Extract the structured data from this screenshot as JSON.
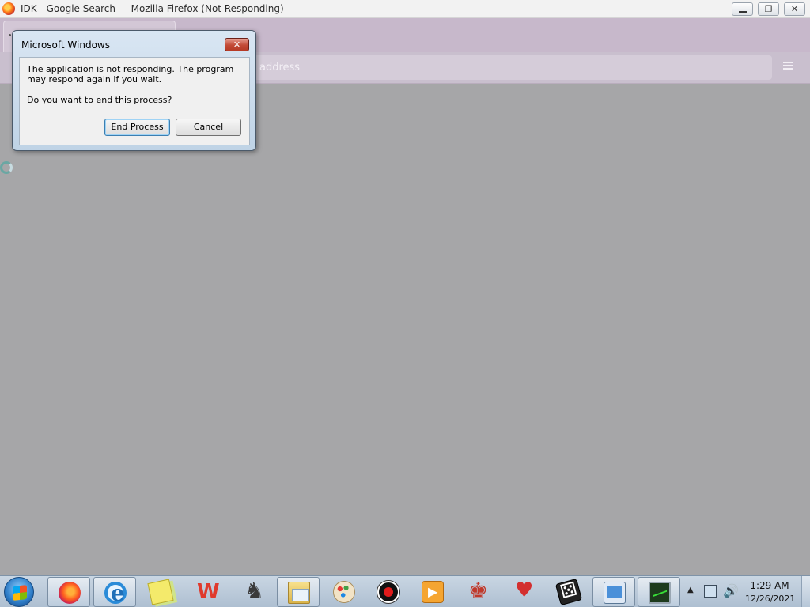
{
  "firefox": {
    "window_title": "IDK - Google Search — Mozilla Firefox (Not Responding)",
    "window_controls": {
      "minimize": "minimize-icon",
      "maximize": "restore-icon",
      "close": "close-icon"
    },
    "urlbar_placeholder": "address",
    "menu_icon": "hamburger-menu-icon"
  },
  "dialog": {
    "title": "Microsoft Windows",
    "message": "The application is not responding. The program may respond again if you wait.",
    "question": "Do you want to end this process?",
    "end_label": "End Process",
    "cancel_label": "Cancel"
  },
  "taskbar": {
    "items": [
      {
        "name": "firefox",
        "icon": "firefox-icon",
        "active": true
      },
      {
        "name": "internet-explorer",
        "icon": "internet-explorer-icon",
        "active": true
      },
      {
        "name": "sticky-notes",
        "icon": "sticky-notes-icon",
        "active": false
      },
      {
        "name": "wps-office",
        "icon": "wps-office-icon",
        "active": false
      },
      {
        "name": "chess",
        "icon": "chess-icon",
        "active": false
      },
      {
        "name": "file-explorer",
        "icon": "folder-icon",
        "active": true
      },
      {
        "name": "paint",
        "icon": "paint-palette-icon",
        "active": false
      },
      {
        "name": "screen-recorder",
        "icon": "record-icon",
        "active": false
      },
      {
        "name": "media-player",
        "icon": "media-player-icon",
        "active": false
      },
      {
        "name": "solitaire",
        "icon": "cards-king-icon",
        "active": false
      },
      {
        "name": "hearts",
        "icon": "hearts-icon",
        "active": false
      },
      {
        "name": "dice-game",
        "icon": "dice-icon",
        "active": false
      },
      {
        "name": "system-info",
        "icon": "system-info-icon",
        "active": true
      },
      {
        "name": "task-manager",
        "icon": "task-manager-icon",
        "active": true
      }
    ],
    "clock": {
      "time": "1:29 AM",
      "date": "12/26/2021"
    }
  },
  "colors": {
    "firefox_theme": "#c7b8cb",
    "content_background": "#a6a6a8",
    "dialog_close": "#c24a36",
    "taskbar": "#b9c9da"
  }
}
